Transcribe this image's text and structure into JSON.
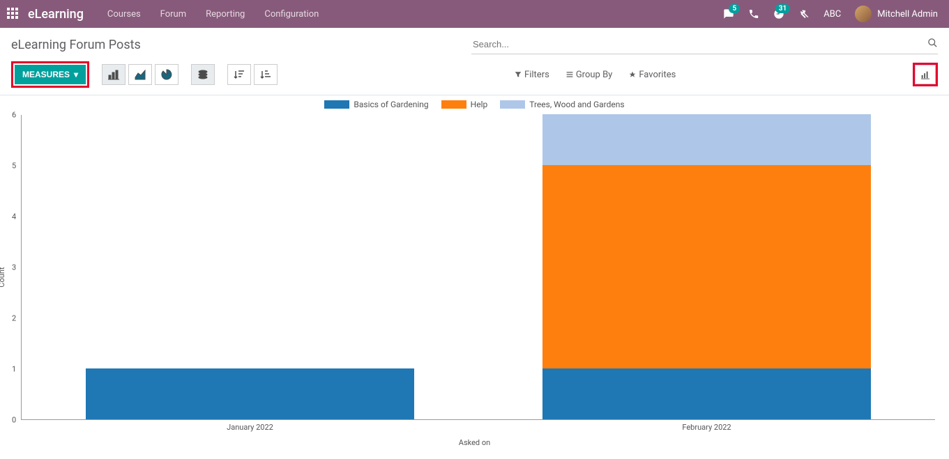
{
  "nav": {
    "brand": "eLearning",
    "links": [
      "Courses",
      "Forum",
      "Reporting",
      "Configuration"
    ],
    "chat_badge": "5",
    "clock_badge": "31",
    "sysabc": "ABC",
    "username": "Mitchell Admin"
  },
  "cp": {
    "title": "eLearning Forum Posts",
    "search_placeholder": "Search...",
    "measures_label": "Measures",
    "filters_label": "Filters",
    "groupby_label": "Group By",
    "favorites_label": "Favorites"
  },
  "colors": {
    "series1": "#1f77b4",
    "series2": "#ff7f0e",
    "series3": "#aec7e8"
  },
  "chart_data": {
    "type": "bar",
    "stacked": true,
    "title": "",
    "xlabel": "Asked on",
    "ylabel": "Count",
    "categories": [
      "January 2022",
      "February 2022"
    ],
    "series": [
      {
        "name": "Basics of Gardening",
        "values": [
          1,
          1
        ],
        "color": "#1f77b4"
      },
      {
        "name": "Help",
        "values": [
          0,
          4
        ],
        "color": "#ff7f0e"
      },
      {
        "name": "Trees, Wood and Gardens",
        "values": [
          0,
          1
        ],
        "color": "#aec7e8"
      }
    ],
    "ylim": [
      0,
      6
    ],
    "yticks": [
      0,
      1,
      2,
      3,
      4,
      5,
      6
    ]
  }
}
